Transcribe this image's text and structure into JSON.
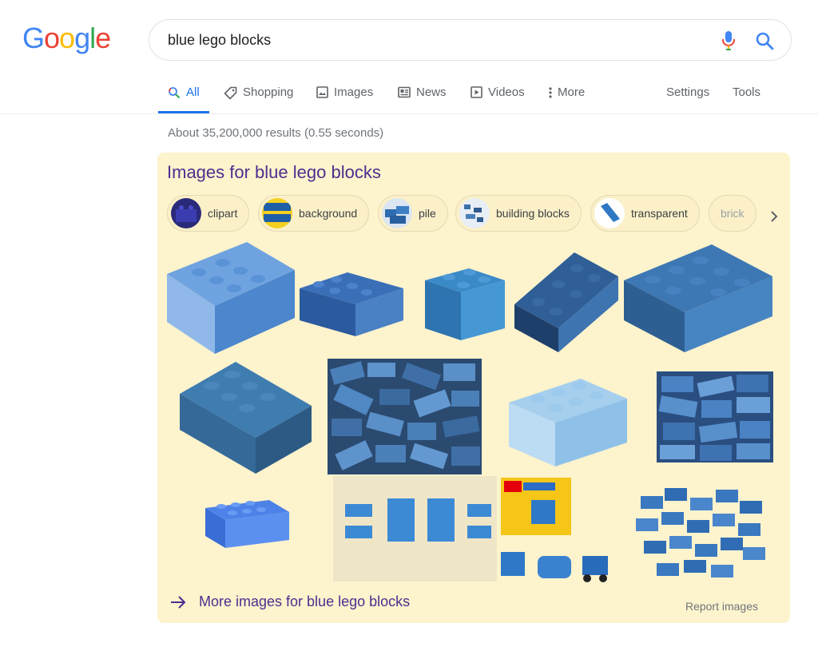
{
  "logo": {
    "letters": [
      "G",
      "o",
      "o",
      "g",
      "l",
      "e"
    ],
    "colors": [
      "#4285f4",
      "#ea4335",
      "#fbbc05",
      "#4285f4",
      "#34a853",
      "#ea4335"
    ]
  },
  "search": {
    "query": "blue lego blocks"
  },
  "tabs": [
    {
      "label": "All",
      "icon": "search-icon",
      "active": true
    },
    {
      "label": "Shopping",
      "icon": "tag-icon"
    },
    {
      "label": "Images",
      "icon": "image-icon"
    },
    {
      "label": "News",
      "icon": "news-icon"
    },
    {
      "label": "Videos",
      "icon": "video-icon"
    },
    {
      "label": "More",
      "icon": "more-vert-icon"
    }
  ],
  "tools": {
    "settings": "Settings",
    "tools": "Tools"
  },
  "stats": "About 35,200,000 results (0.55 seconds)",
  "images_panel": {
    "title": "Images for blue lego blocks",
    "chips": [
      "clipart",
      "background",
      "pile",
      "building blocks",
      "transparent",
      "brick"
    ],
    "more_link": "More images for blue lego blocks",
    "report": "Report images"
  },
  "colors": {
    "accent": "#1a73e8",
    "panel_bg": "#fdf3cd",
    "link_purple": "#4b2f8f",
    "lego_blue": "#3b7fc4"
  }
}
